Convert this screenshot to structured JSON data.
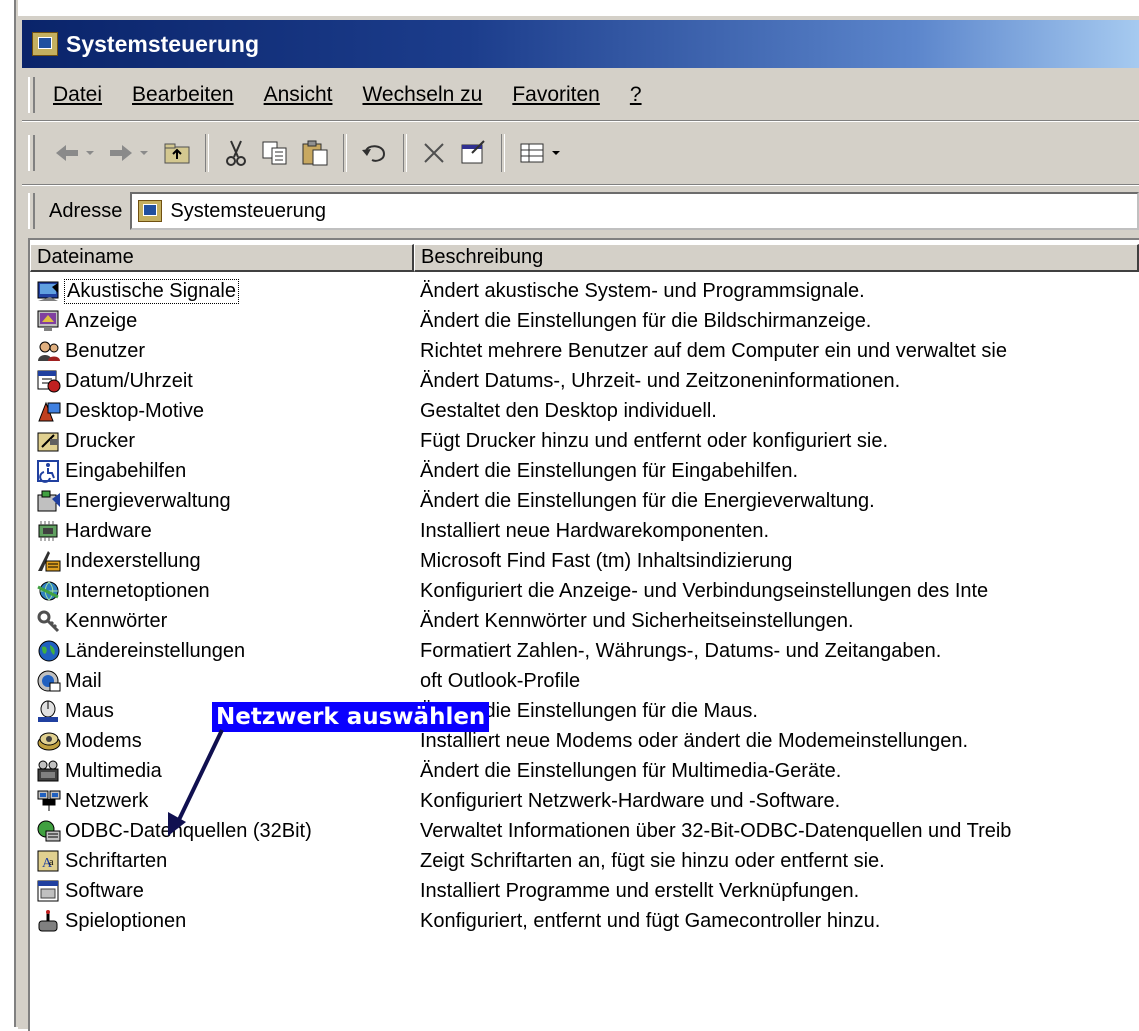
{
  "window": {
    "title": "Systemsteuerung"
  },
  "menu": {
    "items": [
      {
        "label": "Datei"
      },
      {
        "label": "Bearbeiten"
      },
      {
        "label": "Ansicht"
      },
      {
        "label": "Wechseln zu"
      },
      {
        "label": "Favoriten"
      },
      {
        "label": "?"
      }
    ]
  },
  "toolbar": {
    "buttons": [
      "back-icon",
      "forward-icon",
      "up-folder-icon",
      "cut-icon",
      "copy-icon",
      "paste-icon",
      "undo-icon",
      "delete-icon",
      "properties-icon",
      "views-icon"
    ]
  },
  "address": {
    "label": "Adresse",
    "value": "Systemsteuerung"
  },
  "list": {
    "columns": [
      "Dateiname",
      "Beschreibung"
    ],
    "rows": [
      {
        "name": "Akustische Signale",
        "desc": "Ändert akustische System- und Programmsignale.",
        "icon": "sound-icon"
      },
      {
        "name": "Anzeige",
        "desc": "Ändert die Einstellungen für die Bildschirmanzeige.",
        "icon": "display-icon"
      },
      {
        "name": "Benutzer",
        "desc": "Richtet mehrere Benutzer auf dem Computer ein und verwaltet sie",
        "icon": "users-icon"
      },
      {
        "name": "Datum/Uhrzeit",
        "desc": "Ändert Datums-, Uhrzeit- und Zeitzoneninformationen.",
        "icon": "datetime-icon"
      },
      {
        "name": "Desktop-Motive",
        "desc": "Gestaltet den Desktop individuell.",
        "icon": "desktop-themes-icon"
      },
      {
        "name": "Drucker",
        "desc": "Fügt Drucker hinzu und entfernt oder konfiguriert sie.",
        "icon": "printer-icon"
      },
      {
        "name": "Eingabehilfen",
        "desc": "Ändert die Einstellungen für Eingabehilfen.",
        "icon": "accessibility-icon"
      },
      {
        "name": "Energieverwaltung",
        "desc": "Ändert die Einstellungen für die Energieverwaltung.",
        "icon": "power-icon"
      },
      {
        "name": "Hardware",
        "desc": "Installiert neue Hardwarekomponenten.",
        "icon": "hardware-icon"
      },
      {
        "name": "Indexerstellung",
        "desc": "Microsoft Find Fast (tm) Inhaltsindizierung",
        "icon": "indexing-icon"
      },
      {
        "name": "Internetoptionen",
        "desc": "Konfiguriert die Anzeige- und Verbindungseinstellungen des Inte",
        "icon": "internet-icon"
      },
      {
        "name": "Kennwörter",
        "desc": "Ändert Kennwörter und Sicherheitseinstellungen.",
        "icon": "keys-icon"
      },
      {
        "name": "Ländereinstellungen",
        "desc": "Formatiert Zahlen-, Währungs-, Datums- und Zeitangaben.",
        "icon": "globe-icon"
      },
      {
        "name": "Mail",
        "desc": "oft Outlook-Profile",
        "icon": "mail-icon"
      },
      {
        "name": "Maus",
        "desc": "Ändert die Einstellungen für die Maus.",
        "icon": "mouse-icon"
      },
      {
        "name": "Modems",
        "desc": "Installiert neue Modems oder ändert die Modemeinstellungen.",
        "icon": "modem-icon"
      },
      {
        "name": "Multimedia",
        "desc": "Ändert die Einstellungen für Multimedia-Geräte.",
        "icon": "multimedia-icon"
      },
      {
        "name": "Netzwerk",
        "desc": "Konfiguriert Netzwerk-Hardware und -Software.",
        "icon": "network-icon"
      },
      {
        "name": "ODBC-Datenquellen (32Bit)",
        "desc": "Verwaltet Informationen über 32-Bit-ODBC-Datenquellen und Treib",
        "icon": "odbc-icon"
      },
      {
        "name": "Schriftarten",
        "desc": "Zeigt Schriftarten an, fügt sie hinzu oder entfernt sie.",
        "icon": "fonts-icon"
      },
      {
        "name": "Software",
        "desc": "Installiert Programme und erstellt Verknüpfungen.",
        "icon": "software-icon"
      },
      {
        "name": "Spieloptionen",
        "desc": "Konfiguriert, entfernt und fügt Gamecontroller hinzu.",
        "icon": "gamecontroller-icon"
      }
    ]
  },
  "callout": {
    "text": "Netzwerk auswählen",
    "color": "#0a00ff"
  },
  "colors": {
    "titlebar_start": "#0a246a",
    "titlebar_end": "#a6caf0",
    "chrome": "#d4d0c8"
  }
}
